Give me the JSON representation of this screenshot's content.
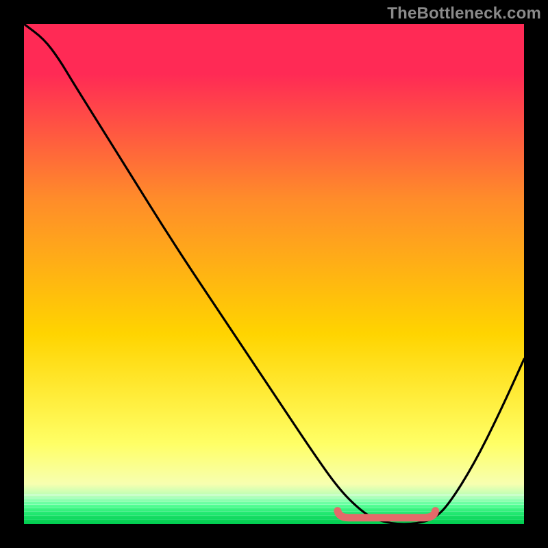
{
  "watermark": "TheBottleneck.com",
  "colors": {
    "bg": "#000000",
    "gradient_top": "#ff2a55",
    "gradient_mid": "#ffb200",
    "gradient_low": "#ffff66",
    "gradient_bottom": "#00e060",
    "gradient_bottom2": "#00c850",
    "gradient_green_band": "#2bff6a",
    "curve": "#000000",
    "highlight": "#e46a6a"
  },
  "chart_data": {
    "type": "line",
    "title": "",
    "xlabel": "",
    "ylabel": "",
    "x_range": [
      0,
      1
    ],
    "y_range": [
      0,
      1
    ],
    "grid": false,
    "legend": false,
    "series": [
      {
        "name": "bottleneck-curve",
        "x": [
          0.0,
          0.04,
          0.07,
          0.1,
          0.15,
          0.2,
          0.3,
          0.4,
          0.5,
          0.58,
          0.63,
          0.67,
          0.7,
          0.74,
          0.78,
          0.82,
          0.85,
          0.9,
          0.95,
          1.0
        ],
        "y": [
          1.0,
          0.97,
          0.93,
          0.88,
          0.8,
          0.72,
          0.56,
          0.41,
          0.26,
          0.14,
          0.07,
          0.03,
          0.01,
          0.0,
          0.0,
          0.01,
          0.04,
          0.12,
          0.22,
          0.33
        ]
      }
    ],
    "highlight_segment": {
      "name": "optimal-range",
      "x_start": 0.63,
      "x_end": 0.82,
      "y": 0.01
    }
  }
}
